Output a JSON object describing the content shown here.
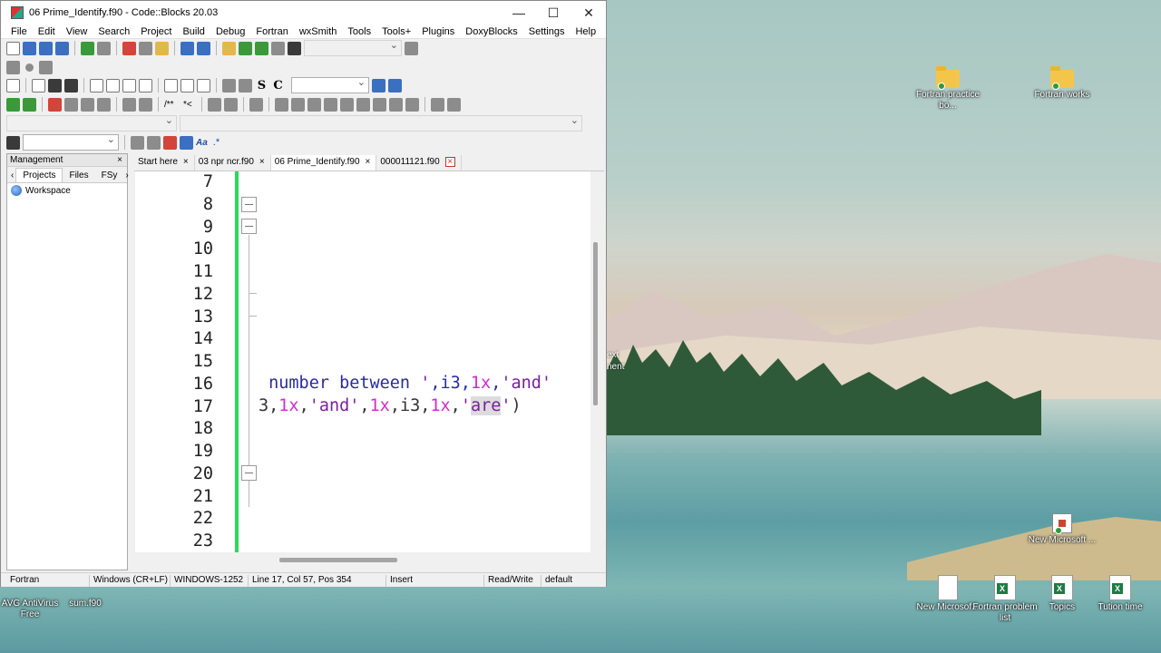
{
  "window": {
    "title": "06 Prime_Identify.f90 - Code::Blocks 20.03",
    "controls": {
      "minimize": "—",
      "maximize": "☐",
      "close": "✕"
    }
  },
  "menu": [
    "File",
    "Edit",
    "View",
    "Search",
    "Project",
    "Build",
    "Debug",
    "Fortran",
    "wxSmith",
    "Tools",
    "Tools+",
    "Plugins",
    "DoxyBlocks",
    "Settings",
    "Help"
  ],
  "toolbar": {
    "search_symbols": {
      "regex_label": ".*",
      "match_case_label": "Aa"
    },
    "format_letters": [
      "S",
      "C"
    ],
    "comment_labels": [
      "/**",
      "*<"
    ]
  },
  "management": {
    "title": "Management",
    "close": "×",
    "tabs": [
      "Projects",
      "Files",
      "FSy"
    ],
    "tree": [
      "Workspace"
    ]
  },
  "editor": {
    "tabs": [
      {
        "label": "Start here",
        "close": "×"
      },
      {
        "label": "03 npr ncr.f90",
        "close": "×"
      },
      {
        "label": "06 Prime_Identify.f90",
        "close": "×"
      },
      {
        "label": "000011121.f90",
        "close": "×"
      }
    ],
    "active_tab": 2,
    "line_numbers": [
      "7",
      "8",
      "9",
      "10",
      "11",
      "12",
      "13",
      "14",
      "15",
      "16",
      "17",
      "18",
      "19",
      "20",
      "21",
      "22",
      "23"
    ],
    "code": {
      "line16": {
        "t1": " number between ",
        "t2": "'",
        "t3": ",i3,",
        "t4": "1x",
        "t5": ",",
        "t6": "'and'"
      },
      "line17": {
        "t1": "3,",
        "t2": "1x",
        "t3": ",",
        "t4": "'and'",
        "t5": ",",
        "t6": "1x",
        "t7": ",i3,",
        "t8": "1x",
        "t9": ",",
        "t10": "'",
        "t11": "are",
        "t12": "'",
        "t13": ")"
      }
    }
  },
  "statusbar": {
    "language": "Fortran",
    "eol": "Windows (CR+LF)",
    "encoding": "WINDOWS-1252",
    "position": "Line 17, Col 57, Pos 354",
    "mode": "Insert",
    "access": "Read/Write",
    "profile": "default"
  },
  "desktop": {
    "icons": [
      {
        "label": "Fortran practice bo..."
      },
      {
        "label": "Fortran works"
      },
      {
        "label": "New Microsoft ..."
      },
      {
        "label": "New Microsof..."
      },
      {
        "label": "Fortran problem list"
      },
      {
        "label": "Topics"
      },
      {
        "label": "Tution time"
      },
      {
        "label": "AVG AntiVirus Free"
      },
      {
        "label": "sum.f90"
      }
    ],
    "partial_text": [
      "ext",
      "nent"
    ]
  }
}
